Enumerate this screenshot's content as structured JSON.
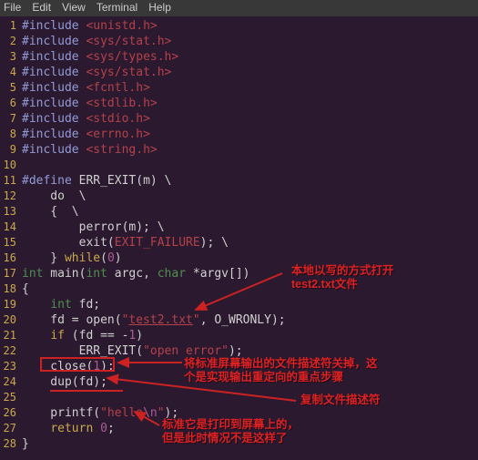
{
  "menu": {
    "items": [
      "File",
      "Edit",
      "View",
      "Terminal",
      "Help"
    ]
  },
  "code": {
    "l1": {
      "a": "#include",
      "b": "<unistd.h>"
    },
    "l2": {
      "a": "#include",
      "b": "<sys/stat.h>"
    },
    "l3": {
      "a": "#include",
      "b": "<sys/types.h>"
    },
    "l4": {
      "a": "#include",
      "b": "<sys/stat.h>"
    },
    "l5": {
      "a": "#include",
      "b": "<fcntl.h>"
    },
    "l6": {
      "a": "#include",
      "b": "<stdlib.h>"
    },
    "l7": {
      "a": "#include",
      "b": "<stdio.h>"
    },
    "l8": {
      "a": "#include",
      "b": "<errno.h>"
    },
    "l9": {
      "a": "#include",
      "b": "<string.h>"
    },
    "l11_a": "#define",
    "l11_b": " ERR_EXIT(m) \\",
    "l12": "    do  \\",
    "l13": "    {  \\",
    "l14": "        perror(m); \\",
    "l15a": "        exit(",
    "l15b": "EXIT_FAILURE",
    "l15c": "); \\",
    "l16a": "    } ",
    "l16b": "while",
    "l16c": "(",
    "l16d": "0",
    "l16e": ")",
    "l17a": "int",
    "l17b": " main(",
    "l17c": "int",
    "l17d": " argc, ",
    "l17e": "char",
    "l17f": " *argv[])",
    "l18": "{",
    "l19a": "    ",
    "l19b": "int",
    "l19c": " fd;",
    "l20a": "    fd = open(",
    "l20b": "\"",
    "l20c": "test2.txt",
    "l20d": "\"",
    "l20e": ", O_WRONLY);",
    "l21a": "    ",
    "l21b": "if",
    "l21c": " (fd == -",
    "l21d": "1",
    "l21e": ")",
    "l22a": "        ERR_EXIT(",
    "l22b": "\"open error\"",
    "l22c": ");",
    "l23a": "    close(",
    "l23b": "1",
    "l23c": ");",
    "l24a": "    dup(fd);",
    "l26a": "    printf(",
    "l26b": "\"hello",
    "l26c": "\\n",
    "l26d": "\"",
    "l26e": ");",
    "l27a": "    ",
    "l27b": "return",
    "l27c": " ",
    "l27d": "0",
    "l27e": ";",
    "l28": "}"
  },
  "ann": {
    "a1": "本地以写的方式打开\ntest2.txt文件",
    "a2": "将标准屏幕输出的文件描述符关掉，这\n个是实现输出重定向的重点步骤",
    "a3": "复制文件描述符",
    "a4": "标准它是打印到屏幕上的，\n但是此时情况不是这样了"
  },
  "linenums": [
    "1",
    "2",
    "3",
    "4",
    "5",
    "6",
    "7",
    "8",
    "9",
    "10",
    "11",
    "12",
    "13",
    "14",
    "15",
    "16",
    "17",
    "18",
    "19",
    "20",
    "21",
    "22",
    "23",
    "24",
    "25",
    "26",
    "27",
    "28"
  ]
}
